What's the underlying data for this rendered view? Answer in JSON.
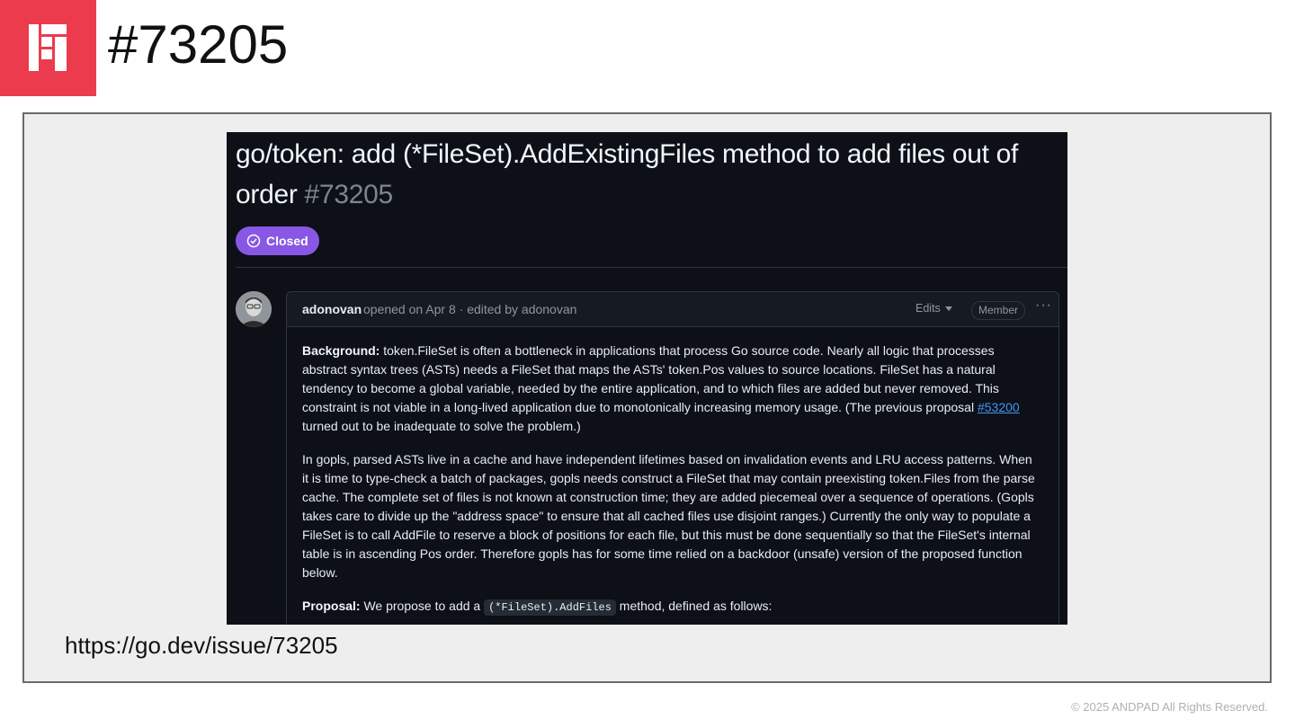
{
  "slide": {
    "title": "#73205",
    "url": "https://go.dev/issue/73205",
    "copyright": "© 2025 ANDPAD All Rights Reserved.",
    "logo_icon": "andpad-logo-icon",
    "brand_color": "#ec3b4d"
  },
  "issue": {
    "title": "go/token: add (*FileSet).AddExistingFiles method to add files out of order",
    "number": "#73205",
    "state": "Closed",
    "state_color": "#8957e5",
    "comment": {
      "author": "adonovan",
      "meta": "opened on Apr 8 · edited by adonovan",
      "edits_label": "Edits",
      "role_badge": "Member",
      "more_label": "···",
      "p1_strong": "Background:",
      "p1_text": " token.FileSet is often a bottleneck in applications that process Go source code. Nearly all logic that processes abstract syntax trees (ASTs) needs a FileSet that maps the ASTs' token.Pos values to source locations. FileSet has a natural tendency to become a global variable, needed by the entire application, and to which files are added but never removed. This constraint is not viable in a long-lived application due to monotonically increasing memory usage. (The previous proposal ",
      "p1_link": "#53200",
      "p1_tail": " turned out to be inadequate to solve the problem.)",
      "p2": "In gopls, parsed ASTs live in a cache and have independent lifetimes based on invalidation events and LRU access patterns. When it is time to type-check a batch of packages, gopls needs construct a FileSet that may contain preexisting token.Files from the parse cache. The complete set of files is not known at construction time; they are added piecemeal over a sequence of operations. (Gopls takes care to divide up the \"address space\" to ensure that all cached files use disjoint ranges.) Currently the only way to populate a FileSet is to call AddFile to reserve a block of positions for each file, but this must be done sequentially so that the FileSet's internal table is in ascending Pos order. Therefore gopls has for some time relied on a backdoor (unsafe) version of the proposed function below.",
      "p3_strong": "Proposal:",
      "p3_text": " We propose to add a ",
      "p3_code": "(*FileSet).AddFiles",
      "p3_tail": " method, defined as follows:"
    }
  }
}
